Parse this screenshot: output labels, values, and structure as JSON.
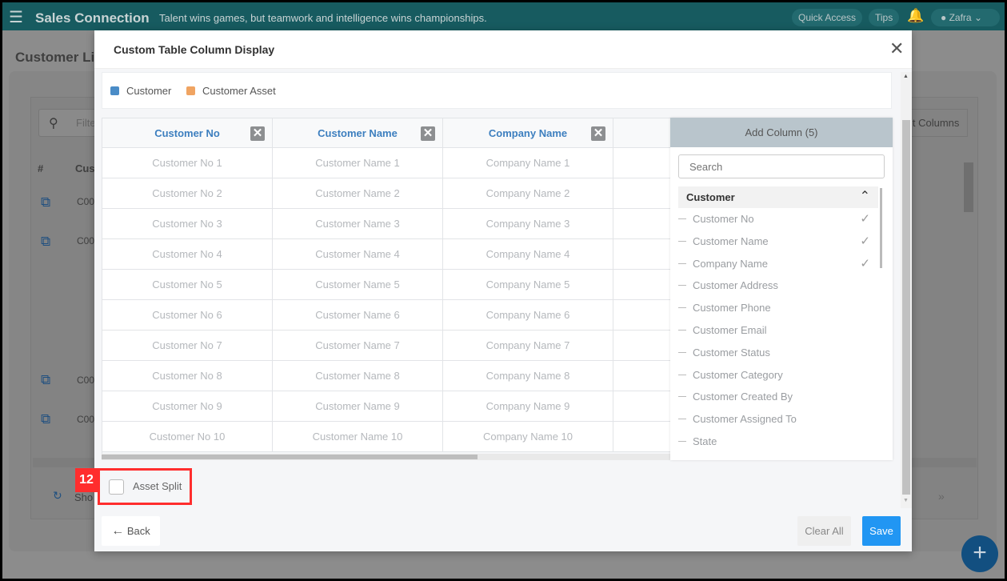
{
  "app": {
    "title": "Sales Connection",
    "tagline": "Talent wins games, but teamwork and intelligence wins championships.",
    "quick_access": "Quick Access",
    "tips": "Tips",
    "user": "Zafra"
  },
  "background": {
    "page_title": "Customer Lis",
    "filter_placeholder": "Filte",
    "columns_button": "lt Columns",
    "table_headers": [
      "#",
      "Cus"
    ],
    "row_codes": [
      "C00",
      "C00",
      "C00",
      "C00"
    ],
    "footer_text": "Sho",
    "next_icon": "»"
  },
  "modal": {
    "title": "Custom Table Column Display",
    "legend": [
      {
        "label": "Customer",
        "color": "#4a8cc7"
      },
      {
        "label": "Customer Asset",
        "color": "#f0a462"
      }
    ],
    "columns": [
      "Customer No",
      "Customer Name",
      "Company Name"
    ],
    "rows": [
      [
        "Customer No 1",
        "Customer Name 1",
        "Company Name 1"
      ],
      [
        "Customer No 2",
        "Customer Name 2",
        "Company Name 2"
      ],
      [
        "Customer No 3",
        "Customer Name 3",
        "Company Name 3"
      ],
      [
        "Customer No 4",
        "Customer Name 4",
        "Company Name 4"
      ],
      [
        "Customer No 5",
        "Customer Name 5",
        "Company Name 5"
      ],
      [
        "Customer No 6",
        "Customer Name 6",
        "Company Name 6"
      ],
      [
        "Customer No 7",
        "Customer Name 7",
        "Company Name 7"
      ],
      [
        "Customer No 8",
        "Customer Name 8",
        "Company Name 8"
      ],
      [
        "Customer No 9",
        "Customer Name 9",
        "Company Name 9"
      ],
      [
        "Customer No 10",
        "Customer Name 10",
        "Company Name 10"
      ]
    ],
    "add_column": {
      "title": "Add Column (5)",
      "search_placeholder": "Search",
      "group": "Customer",
      "items": [
        {
          "label": "Customer No",
          "checked": true
        },
        {
          "label": "Customer Name",
          "checked": true
        },
        {
          "label": "Company Name",
          "checked": true
        },
        {
          "label": "Customer Address",
          "checked": false
        },
        {
          "label": "Customer Phone",
          "checked": false
        },
        {
          "label": "Customer Email",
          "checked": false
        },
        {
          "label": "Customer Status",
          "checked": false
        },
        {
          "label": "Customer Category",
          "checked": false
        },
        {
          "label": "Customer Created By",
          "checked": false
        },
        {
          "label": "Customer Assigned To",
          "checked": false
        },
        {
          "label": "State",
          "checked": false
        }
      ]
    },
    "asset_split": {
      "label": "Asset Split",
      "checked": false,
      "badge": "12"
    },
    "back": "Back",
    "clear_all": "Clear All",
    "save": "Save"
  },
  "colors": {
    "header": "#175b60",
    "accent": "#3d7fbf",
    "save": "#2196f3",
    "badge": "#ff2d2d"
  }
}
